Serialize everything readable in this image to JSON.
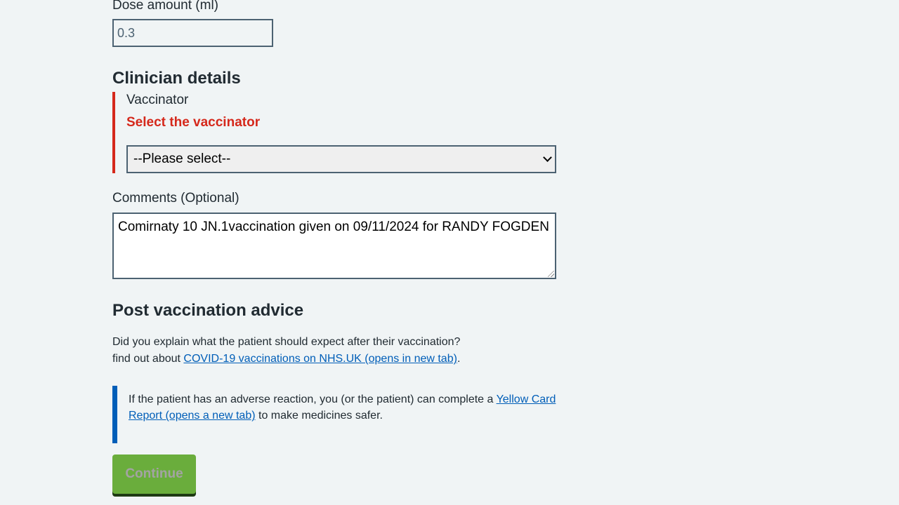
{
  "dose": {
    "label": "Dose amount (ml)",
    "value": "0.3"
  },
  "clinician": {
    "heading": "Clinician details",
    "vaccinator_label": "Vaccinator",
    "error_message": "Select the vaccinator",
    "select_value": "--Please select--"
  },
  "comments": {
    "label": "Comments (Optional)",
    "value": "Comirnaty 10 JN.1vaccination given on 09/11/2024 for RANDY FOGDEN"
  },
  "advice": {
    "heading": "Post vaccination advice",
    "question": "Did you explain what the patient should expect after their vaccination?",
    "find_out_prefix": "find out about ",
    "covid_link": "COVID-19 vaccinations on NHS.UK (opens in new tab)",
    "find_out_suffix": "."
  },
  "inset": {
    "text_before": "If the patient has an adverse reaction, you (or the patient) can complete a ",
    "link": "Yellow Card Report (opens a new tab)",
    "text_after": " to make medicines safer."
  },
  "actions": {
    "continue_label": "Continue"
  },
  "colors": {
    "background": "#f0f4f5",
    "error": "#d5281b",
    "link": "#005eb8",
    "button": "#6aad3c"
  }
}
